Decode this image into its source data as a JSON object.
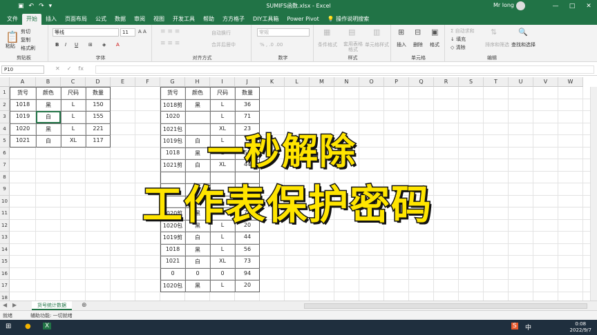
{
  "window": {
    "title": "SUMIFS函数.xlsx  -  Excel",
    "user": "Mr long"
  },
  "tabs": [
    "文件",
    "开始",
    "插入",
    "页面布局",
    "公式",
    "数据",
    "审阅",
    "视图",
    "开发工具",
    "帮助",
    "方方格子",
    "DIY工具箱",
    "Power Pivot",
    "操作说明搜索"
  ],
  "ribbon": {
    "clipboard": {
      "cut": "剪切",
      "copy": "复制",
      "painter": "格式刷",
      "paste": "粘贴",
      "label": "剪贴板"
    },
    "font": {
      "name": "等线",
      "size": "11",
      "label": "字体"
    },
    "align": {
      "wrap": "自动换行",
      "merge": "合并后居中",
      "label": "对齐方式"
    },
    "number": {
      "format": "常规",
      "label": "数字"
    },
    "styles": {
      "cond": "条件格式",
      "table": "套用表格格式",
      "cell": "单元格样式",
      "label": "样式"
    },
    "cells": {
      "insert": "插入",
      "delete": "删除",
      "format": "格式",
      "label": "单元格"
    },
    "editing": {
      "autosum": "自动求和",
      "fill": "填充",
      "clear": "清除",
      "sort": "排序和筛选",
      "find": "查找和选择",
      "label": "编辑"
    }
  },
  "formula": {
    "namebox": "P10"
  },
  "columns": [
    "A",
    "B",
    "C",
    "D",
    "E",
    "F",
    "G",
    "H",
    "I",
    "J",
    "K",
    "L",
    "M",
    "N",
    "O",
    "P",
    "Q",
    "R",
    "S",
    "T",
    "U",
    "V",
    "W"
  ],
  "rows": [
    "1",
    "2",
    "3",
    "4",
    "5",
    "6",
    "7",
    "8",
    "9",
    "10",
    "11",
    "12",
    "13",
    "14",
    "15",
    "16",
    "17",
    "18"
  ],
  "table1": {
    "headers": [
      "货号",
      "颜色",
      "尺码",
      "数量"
    ],
    "rows": [
      [
        "1018",
        "黑",
        "L",
        "150"
      ],
      [
        "1019",
        "白",
        "L",
        "155"
      ],
      [
        "1020",
        "黑",
        "L",
        "221"
      ],
      [
        "1021",
        "白",
        "XL",
        "117"
      ]
    ]
  },
  "table2": {
    "headers": [
      "货号",
      "颜色",
      "尺码",
      "数量"
    ],
    "rows": [
      [
        "1018剪",
        "黑",
        "L",
        "36"
      ],
      [
        "1020",
        "",
        "L",
        "71"
      ],
      [
        "1021包",
        "",
        "XL",
        "23"
      ],
      [
        "1019包",
        "白",
        "L",
        ""
      ],
      [
        "1018",
        "黑",
        "L",
        "58"
      ],
      [
        "1021剪",
        "白",
        "XL",
        "44"
      ],
      [
        "",
        "",
        "",
        ""
      ],
      [
        "",
        "",
        "",
        ""
      ],
      [
        "",
        "",
        "",
        ""
      ],
      [
        "1020剪",
        "黑",
        "L",
        "74"
      ],
      [
        "1020包",
        "黑",
        "L",
        "20"
      ],
      [
        "1019剪",
        "白",
        "L",
        "44"
      ],
      [
        "1018",
        "黑",
        "L",
        "56"
      ],
      [
        "1021",
        "白",
        "XL",
        "73"
      ],
      [
        "0",
        "0",
        "0",
        "94"
      ],
      [
        "1020包",
        "黑",
        "L",
        "20"
      ]
    ]
  },
  "overlay": {
    "line1": "一秒解除",
    "line2": "工作表保护密码"
  },
  "sheet": {
    "tab": "货号统计数据"
  },
  "status": {
    "ready": "就绪",
    "accessibility": "辅助功能: 一切就绪"
  },
  "clock": {
    "time": "0:08",
    "date": "2022/9/7"
  },
  "taskbar": {
    "ime": "中"
  },
  "colors": {
    "accent": "#217346",
    "overlay": "#ffe500"
  }
}
